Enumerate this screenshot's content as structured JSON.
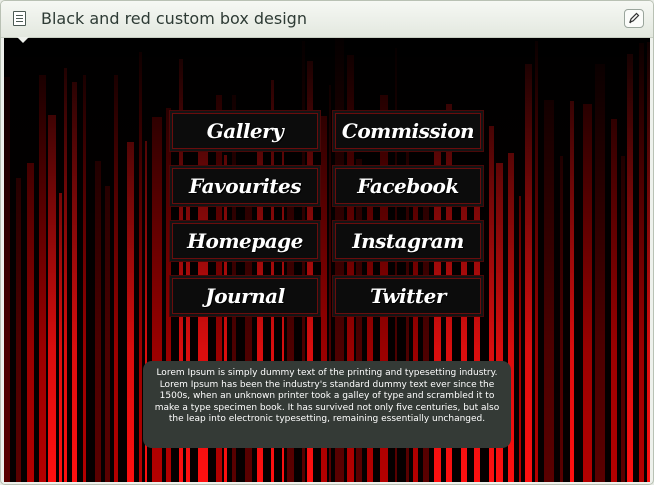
{
  "window": {
    "title": "Black and red custom box design",
    "title_icon": "document-icon",
    "edit_icon": "pencil-icon"
  },
  "theme": {
    "background": "#050000",
    "stripe_red": "#e00000",
    "button_bg": "#0c0c0c",
    "button_border": "#6a0d0d",
    "info_bg": "#343a36"
  },
  "nav": [
    {
      "label": "Gallery"
    },
    {
      "label": "Commission"
    },
    {
      "label": "Favourites"
    },
    {
      "label": "Facebook"
    },
    {
      "label": "Homepage"
    },
    {
      "label": "Instagram"
    },
    {
      "label": "Journal"
    },
    {
      "label": "Twitter"
    }
  ],
  "info": {
    "text": "Lorem Ipsum is simply dummy text of the printing and typesetting industry. Lorem Ipsum has been the industry's standard dummy text ever since the 1500s, when an unknown printer took a galley of type and scrambled it to make a type specimen book. It has survived not only five centuries, but also the leap into electronic typesetting, remaining essentially unchanged."
  }
}
